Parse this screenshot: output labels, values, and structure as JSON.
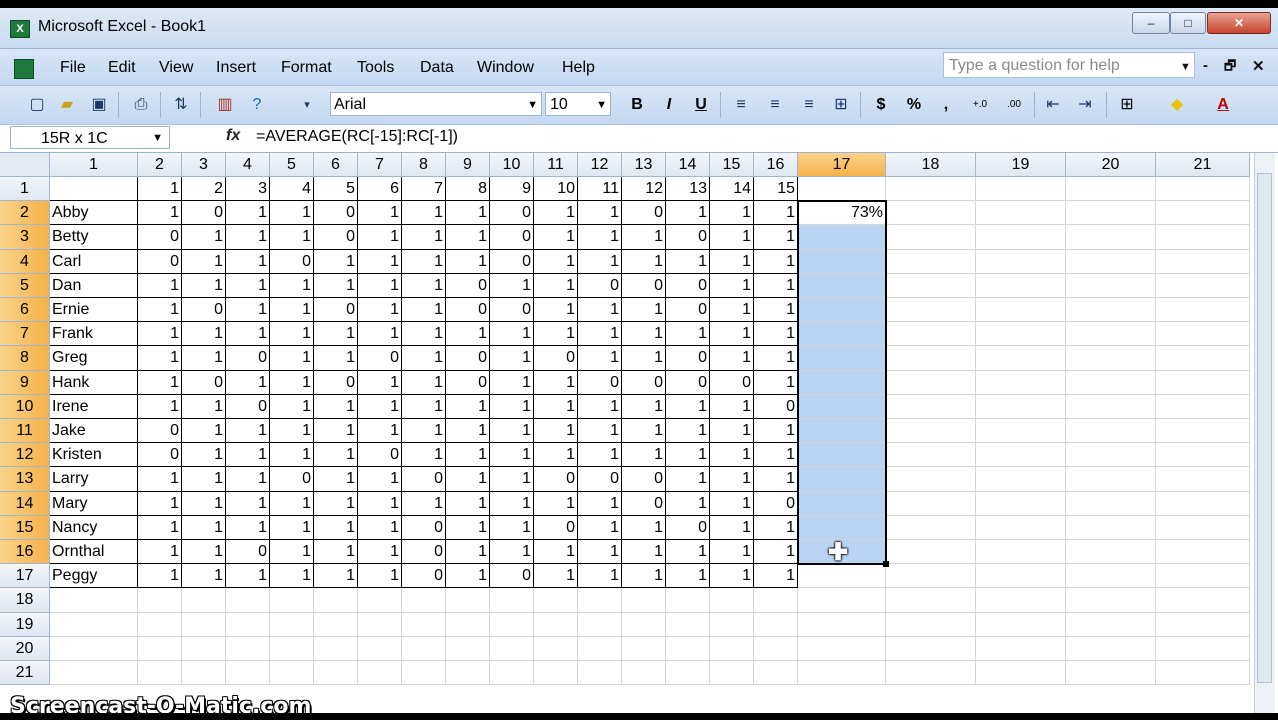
{
  "window": {
    "title": "Microsoft Excel - Book1",
    "app_icon": "X",
    "buttons": {
      "minimize": "–",
      "maximize": "□",
      "close": "✕"
    }
  },
  "menubar": {
    "items": [
      "File",
      "Edit",
      "View",
      "Insert",
      "Format",
      "Tools",
      "Data",
      "Window",
      "Help"
    ],
    "help_placeholder": "Type a question for help",
    "doc_buttons": {
      "minimize": "-",
      "restore": "🗗",
      "close": "✕"
    }
  },
  "toolbar": {
    "font": "Arial",
    "size": "10",
    "bold": "B",
    "italic": "I",
    "underline": "U",
    "currency": "$",
    "percent": "%",
    "comma": ",",
    "increase_decimal": "+.0",
    "decrease_decimal": ".00",
    "font_color_letter": "A"
  },
  "formula_bar": {
    "name_box": "15R x 1C",
    "fx": "fx",
    "formula": "=AVERAGE(RC[-15]:RC[-1])"
  },
  "grid": {
    "column_headers": [
      "1",
      "2",
      "3",
      "4",
      "5",
      "6",
      "7",
      "8",
      "9",
      "10",
      "11",
      "12",
      "13",
      "14",
      "15",
      "16",
      "17",
      "18",
      "19",
      "20",
      "21"
    ],
    "row_headers": [
      "1",
      "2",
      "3",
      "4",
      "5",
      "6",
      "7",
      "8",
      "9",
      "10",
      "11",
      "12",
      "13",
      "14",
      "15",
      "16",
      "17",
      "18",
      "19",
      "20",
      "21"
    ],
    "selected_column": "17",
    "selected_rows": [
      "2",
      "3",
      "4",
      "5",
      "6",
      "7",
      "8",
      "9",
      "10",
      "11",
      "12",
      "13",
      "14",
      "15",
      "16"
    ],
    "header_row": [
      "1",
      "2",
      "3",
      "4",
      "5",
      "6",
      "7",
      "8",
      "9",
      "10",
      "11",
      "12",
      "13",
      "14",
      "15"
    ],
    "rows": [
      {
        "name": "Abby",
        "values": [
          "1",
          "0",
          "1",
          "1",
          "0",
          "1",
          "1",
          "1",
          "0",
          "1",
          "1",
          "0",
          "1",
          "1",
          "1"
        ],
        "avg": "73%"
      },
      {
        "name": "Betty",
        "values": [
          "0",
          "1",
          "1",
          "1",
          "0",
          "1",
          "1",
          "1",
          "0",
          "1",
          "1",
          "1",
          "0",
          "1",
          "1"
        ],
        "avg": ""
      },
      {
        "name": "Carl",
        "values": [
          "0",
          "1",
          "1",
          "0",
          "1",
          "1",
          "1",
          "1",
          "0",
          "1",
          "1",
          "1",
          "1",
          "1",
          "1"
        ],
        "avg": ""
      },
      {
        "name": "Dan",
        "values": [
          "1",
          "1",
          "1",
          "1",
          "1",
          "1",
          "1",
          "0",
          "1",
          "1",
          "0",
          "0",
          "0",
          "1",
          "1"
        ],
        "avg": ""
      },
      {
        "name": "Ernie",
        "values": [
          "1",
          "0",
          "1",
          "1",
          "0",
          "1",
          "1",
          "0",
          "0",
          "1",
          "1",
          "1",
          "0",
          "1",
          "1"
        ],
        "avg": ""
      },
      {
        "name": "Frank",
        "values": [
          "1",
          "1",
          "1",
          "1",
          "1",
          "1",
          "1",
          "1",
          "1",
          "1",
          "1",
          "1",
          "1",
          "1",
          "1"
        ],
        "avg": ""
      },
      {
        "name": "Greg",
        "values": [
          "1",
          "1",
          "0",
          "1",
          "1",
          "0",
          "1",
          "0",
          "1",
          "0",
          "1",
          "1",
          "0",
          "1",
          "1"
        ],
        "avg": ""
      },
      {
        "name": "Hank",
        "values": [
          "1",
          "0",
          "1",
          "1",
          "0",
          "1",
          "1",
          "0",
          "1",
          "1",
          "0",
          "0",
          "0",
          "0",
          "1"
        ],
        "avg": ""
      },
      {
        "name": "Irene",
        "values": [
          "1",
          "1",
          "0",
          "1",
          "1",
          "1",
          "1",
          "1",
          "1",
          "1",
          "1",
          "1",
          "1",
          "1",
          "0"
        ],
        "avg": ""
      },
      {
        "name": "Jake",
        "values": [
          "0",
          "1",
          "1",
          "1",
          "1",
          "1",
          "1",
          "1",
          "1",
          "1",
          "1",
          "1",
          "1",
          "1",
          "1"
        ],
        "avg": ""
      },
      {
        "name": "Kristen",
        "values": [
          "0",
          "1",
          "1",
          "1",
          "1",
          "0",
          "1",
          "1",
          "1",
          "1",
          "1",
          "1",
          "1",
          "1",
          "1"
        ],
        "avg": ""
      },
      {
        "name": "Larry",
        "values": [
          "1",
          "1",
          "1",
          "0",
          "1",
          "1",
          "0",
          "1",
          "1",
          "0",
          "0",
          "0",
          "1",
          "1",
          "1"
        ],
        "avg": ""
      },
      {
        "name": "Mary",
        "values": [
          "1",
          "1",
          "1",
          "1",
          "1",
          "1",
          "1",
          "1",
          "1",
          "1",
          "1",
          "0",
          "1",
          "1",
          "0"
        ],
        "avg": ""
      },
      {
        "name": "Nancy",
        "values": [
          "1",
          "1",
          "1",
          "1",
          "1",
          "1",
          "0",
          "1",
          "1",
          "0",
          "1",
          "1",
          "0",
          "1",
          "1"
        ],
        "avg": ""
      },
      {
        "name": "Ornthal",
        "values": [
          "1",
          "1",
          "0",
          "1",
          "1",
          "1",
          "0",
          "1",
          "1",
          "1",
          "1",
          "1",
          "1",
          "1",
          "1"
        ],
        "avg": ""
      },
      {
        "name": "Peggy",
        "values": [
          "1",
          "1",
          "1",
          "1",
          "1",
          "1",
          "0",
          "1",
          "0",
          "1",
          "1",
          "1",
          "1",
          "1",
          "1"
        ],
        "avg": ""
      }
    ]
  },
  "watermark": "Screencast-O-Matic.com",
  "colors": {
    "selection_fill": "#b9d3f2",
    "header_selected": "#f5b14a",
    "chrome": "#c3d8f1"
  }
}
